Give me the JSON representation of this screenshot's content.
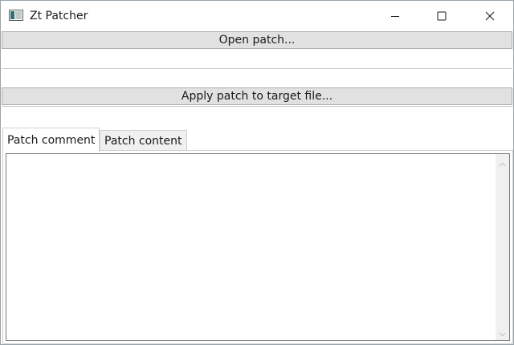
{
  "window": {
    "title": "Zt Patcher",
    "icons": {
      "app": "app-window-icon",
      "minimize": "minimize-icon",
      "maximize": "maximize-icon",
      "close": "close-icon"
    }
  },
  "toolbar": {
    "open_label": "Open patch...",
    "apply_label": "Apply patch to target file...",
    "patch_path_value": "",
    "target_path_value": ""
  },
  "tabs": [
    {
      "label": "Patch comment",
      "selected": true
    },
    {
      "label": "Patch content",
      "selected": false
    }
  ],
  "comment": {
    "text": ""
  },
  "colors": {
    "button_face": "#e1e1e1",
    "button_border": "#adadad",
    "tab_inactive": "#f0f0f0"
  }
}
